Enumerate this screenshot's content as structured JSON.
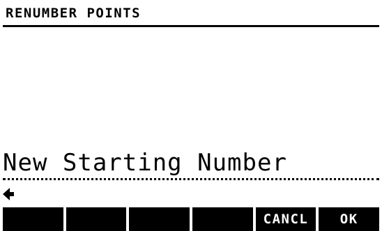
{
  "screen": {
    "title": "RENUMBER POINTS"
  },
  "prompt": {
    "label": "New Starting Number",
    "value": "",
    "cursor_icon": "left-arrow-cursor-icon"
  },
  "softkeys": [
    {
      "label": ""
    },
    {
      "label": ""
    },
    {
      "label": ""
    },
    {
      "label": ""
    },
    {
      "label": "CANCL"
    },
    {
      "label": "OK"
    }
  ],
  "colors": {
    "background": "#ffffff",
    "foreground": "#000000",
    "softkey_text": "#ffffff"
  }
}
